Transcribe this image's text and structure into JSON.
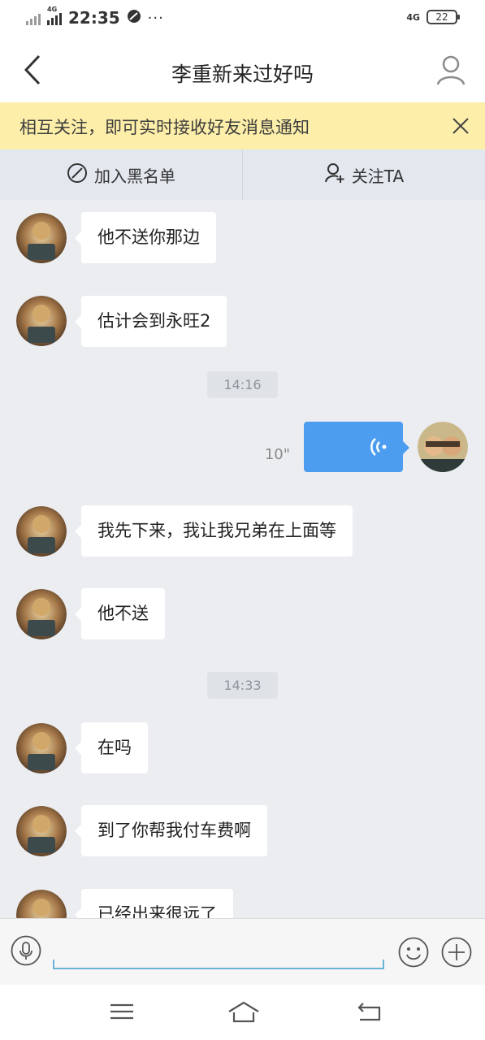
{
  "status_bar": {
    "network_label": "4G",
    "time": "22:35",
    "more": "···",
    "right_network": "4G",
    "battery": "22"
  },
  "header": {
    "title": "李重新来过好吗",
    "back_icon": "chevron-left-icon",
    "profile_icon": "person-icon"
  },
  "notice": {
    "text": "相互关注，即可实时接收好友消息通知",
    "close_icon": "close-icon"
  },
  "actions": {
    "block_label": "加入黑名单",
    "follow_label": "关注TA"
  },
  "messages": [
    {
      "side": "left",
      "text": "他不送你那边"
    },
    {
      "side": "left",
      "text": "估计会到永旺2"
    },
    {
      "type": "time",
      "text": "14:16"
    },
    {
      "side": "right",
      "type": "voice",
      "duration": "10\""
    },
    {
      "side": "left",
      "text": "我先下来，我让我兄弟在上面等"
    },
    {
      "side": "left",
      "text": "他不送"
    },
    {
      "type": "time",
      "text": "14:33"
    },
    {
      "side": "left",
      "text": "在吗"
    },
    {
      "side": "left",
      "text": "到了你帮我付车费啊"
    },
    {
      "side": "left",
      "text": "已经出来很远了"
    }
  ],
  "input": {
    "placeholder": "",
    "voice_icon": "microphone-icon",
    "emoji_icon": "smiley-icon",
    "plus_icon": "plus-icon"
  },
  "navbar": {
    "menu_icon": "menu-icon",
    "home_icon": "home-icon",
    "back_icon": "back-arrow-icon"
  },
  "colors": {
    "notice_bg": "#fdefa9",
    "voice_bubble": "#4c9df0",
    "chat_bg": "#ebedf1"
  }
}
